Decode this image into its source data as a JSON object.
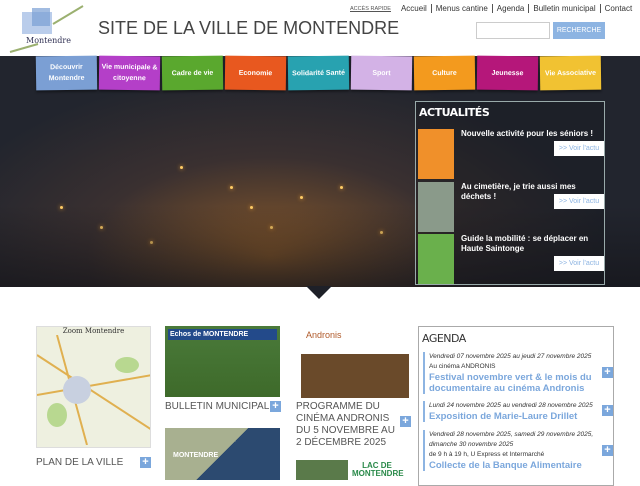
{
  "header": {
    "logo_text": "Montendre",
    "title": "SITE DE LA VILLE DE MONTENDRE",
    "quick_access": "ACCÈS RAPIDE",
    "links": [
      "Accueil",
      "Menus cantine",
      "Agenda",
      "Bulletin municipal",
      "Contact"
    ],
    "search_placeholder": "",
    "search_button": "RECHERCHE"
  },
  "nav": [
    {
      "label": "Découvrir Montendre",
      "color": "#7b9fd4"
    },
    {
      "label": "Vie municipale & citoyenne",
      "color": "#b43fc8"
    },
    {
      "label": "Cadre de vie",
      "color": "#5aa82e"
    },
    {
      "label": "Economie",
      "color": "#e8581f"
    },
    {
      "label": "Solidarité Santé",
      "color": "#28a2b0"
    },
    {
      "label": "Sport",
      "color": "#d3b2e6"
    },
    {
      "label": "Culture",
      "color": "#f39a1e"
    },
    {
      "label": "Jeunesse",
      "color": "#b5177a"
    },
    {
      "label": "Vie Associative",
      "color": "#f1c232"
    }
  ],
  "news": {
    "title": "ACTUALITÉS",
    "button": ">> Voir l'actu",
    "items": [
      {
        "title": "Nouvelle activité pour les séniors !"
      },
      {
        "title": "Au cimetière, je trie aussi mes déchets !"
      },
      {
        "title": "Guide la mobilité : se déplacer en Haute Saintonge"
      }
    ]
  },
  "tiles": {
    "plan": "PLAN DE LA VILLE",
    "plan_img": "Zoom Montendre",
    "bulletin": "BULLETIN MUNICIPAL",
    "bulletin_img": "Echos de MONTENDRE",
    "cinema": "PROGRAMME DU CINÉMA ANDRONIS DU 5 NOVEMBRE AU 2 DÉCEMBRE 2025",
    "cinema_img": "Andronis",
    "montendre_img": "MONTENDRE",
    "lac_img": "LAC DE MONTENDRE"
  },
  "agenda": {
    "title": "AGENDA",
    "events": [
      {
        "date": "Vendredi 07 novembre 2025 au jeudi 27 novembre 2025",
        "place": "Au cinéma ANDRONIS",
        "title": "Festival novembre vert & le mois du documentaire au cinéma Andronis"
      },
      {
        "date": "Lundi 24 novembre 2025 au vendredi 28 novembre 2025",
        "place": "",
        "title": "Exposition de Marie-Laure Drillet"
      },
      {
        "date": "Vendredi 28 novembre 2025, samedi 29 novembre 2025, dimanche 30 novembre 2025",
        "place": "de 9 h à 19 h, U Express et Intermarché",
        "title": "Collecte de la Banque Alimentaire"
      }
    ]
  }
}
